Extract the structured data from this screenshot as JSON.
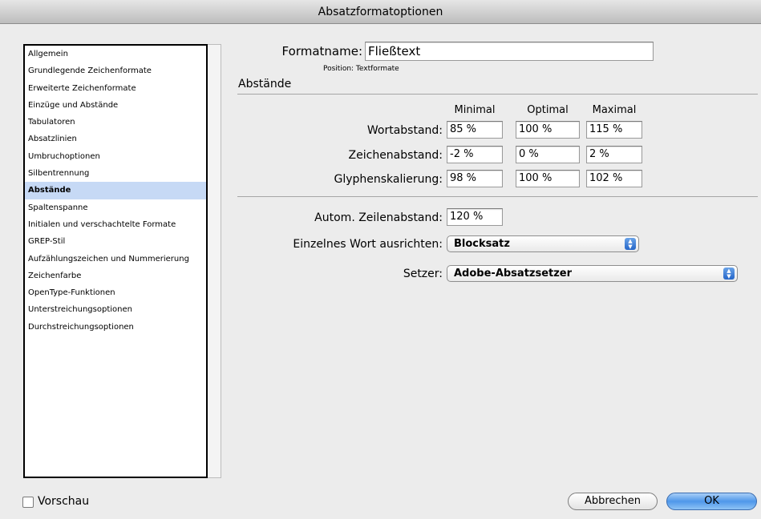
{
  "window": {
    "title": "Absatzformatoptionen"
  },
  "sidebar": {
    "items": [
      {
        "label": "Allgemein"
      },
      {
        "label": "Grundlegende Zeichenformate"
      },
      {
        "label": "Erweiterte Zeichenformate"
      },
      {
        "label": "Einzüge und Abstände"
      },
      {
        "label": "Tabulatoren"
      },
      {
        "label": "Absatzlinien"
      },
      {
        "label": "Umbruchoptionen"
      },
      {
        "label": "Silbentrennung"
      },
      {
        "label": "Abstände",
        "selected": true
      },
      {
        "label": "Spaltenspanne"
      },
      {
        "label": "Initialen und verschachtelte Formate"
      },
      {
        "label": "GREP-Stil"
      },
      {
        "label": "Aufzählungszeichen und Nummerierung"
      },
      {
        "label": "Zeichenfarbe"
      },
      {
        "label": "OpenType-Funktionen"
      },
      {
        "label": "Unterstreichungsoptionen"
      },
      {
        "label": "Durchstreichungsoptionen"
      }
    ]
  },
  "format": {
    "name_label": "Formatname:",
    "name_value": "Fließtext",
    "position_text": "Position: Textformate"
  },
  "section": {
    "title": "Abstände"
  },
  "spacing": {
    "headers": {
      "min": "Minimal",
      "opt": "Optimal",
      "max": "Maximal"
    },
    "rows": [
      {
        "label": "Wortabstand:",
        "min": "85 %",
        "opt": "100 %",
        "max": "115 %"
      },
      {
        "label": "Zeichenabstand:",
        "min": "-2 %",
        "opt": "0 %",
        "max": "2 %"
      },
      {
        "label": "Glyphenskalierung:",
        "min": "98 %",
        "opt": "100 %",
        "max": "102 %"
      }
    ]
  },
  "auto_leading": {
    "label": "Autom. Zeilenabstand:",
    "value": "120 %"
  },
  "single_word": {
    "label": "Einzelnes Wort ausrichten:",
    "value": "Blocksatz"
  },
  "composer": {
    "label": "Setzer:",
    "value": "Adobe-Absatzsetzer"
  },
  "preview": {
    "label": "Vorschau",
    "checked": false
  },
  "buttons": {
    "cancel": "Abbrechen",
    "ok": "OK"
  },
  "colors": {
    "selection": "#c6d9f5",
    "default_button": "#4f97ea"
  }
}
